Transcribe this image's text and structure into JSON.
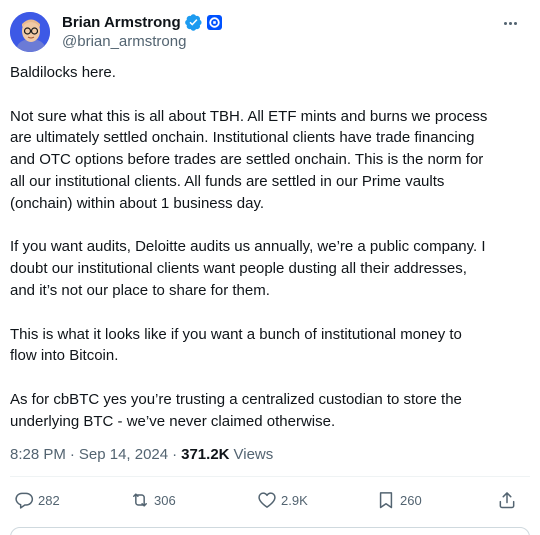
{
  "author": {
    "display_name": "Brian Armstrong",
    "handle": "@brian_armstrong"
  },
  "icons": {
    "verified": "verified-badge-icon",
    "affiliate": "coinbase-affiliate-icon",
    "more": "more-options-icon",
    "reply": "reply-icon",
    "repost": "repost-icon",
    "like": "heart-icon",
    "bookmark": "bookmark-icon",
    "share": "share-icon"
  },
  "colors": {
    "verified_blue": "#1d9bf0",
    "affiliate_blue": "#0052ff",
    "secondary_text": "#536471"
  },
  "tweet": {
    "paragraphs": [
      [
        "Baldilocks here."
      ],
      [
        "Not sure what this is all about TBH. All ETF mints and burns we process",
        "are ultimately settled onchain. Institutional clients have trade financing",
        "and OTC options before trades are settled onchain. This is the norm for",
        "all our institutional clients. All funds are settled in our Prime vaults",
        "(onchain) within about 1 business day."
      ],
      [
        "If you want audits, Deloitte audits us annually, we’re a public company. I",
        "doubt our institutional clients want people dusting all their addresses,",
        "and it’s not our place to share for them."
      ],
      [
        "This is what it looks like if you want a bunch of institutional money to",
        "flow into Bitcoin."
      ],
      [
        "As for cbBTC yes you’re trusting a centralized custodian to store the",
        "underlying BTC - we’ve never claimed otherwise."
      ]
    ]
  },
  "meta": {
    "time": "8:28 PM",
    "separator": "·",
    "date": "Sep 14, 2024",
    "views_count": "371.2K",
    "views_label": "Views"
  },
  "actions": {
    "replies": "282",
    "reposts": "306",
    "likes": "2.9K",
    "bookmarks": "260"
  }
}
